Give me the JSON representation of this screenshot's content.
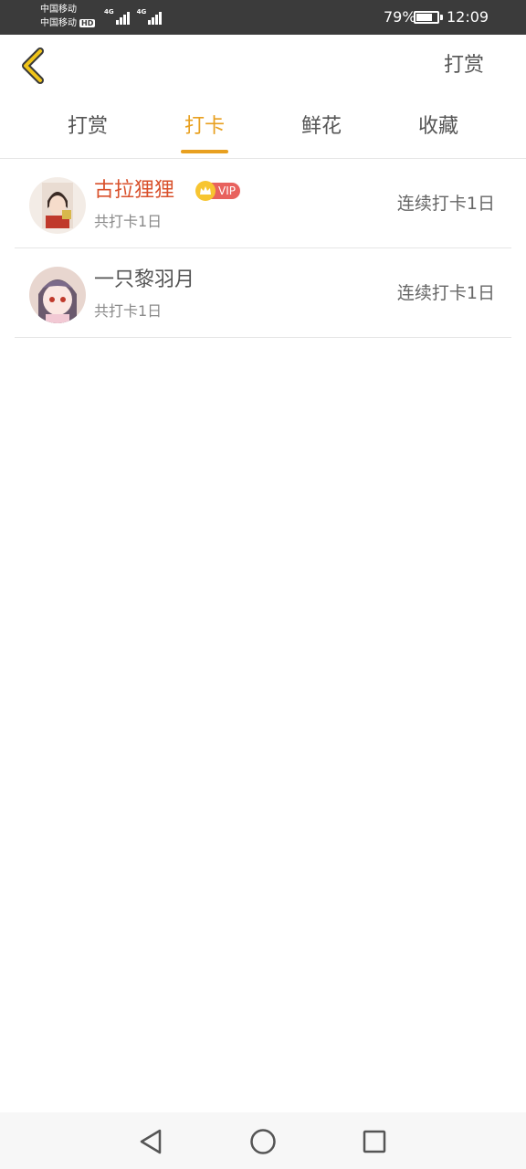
{
  "status_bar": {
    "carrier1": "中国移动",
    "carrier2": "中国移动",
    "hd": "HD",
    "network1": "4G",
    "network2": "4G",
    "battery_percent": "79%",
    "battery_level": 0.79,
    "time": "12:09"
  },
  "header": {
    "back_icon": "chevron-left-icon",
    "action_label": "打赏"
  },
  "tabs": [
    {
      "label": "打赏",
      "active": false
    },
    {
      "label": "打卡",
      "active": true
    },
    {
      "label": "鲜花",
      "active": false
    },
    {
      "label": "收藏",
      "active": false
    }
  ],
  "colors": {
    "accent": "#e8a020",
    "vip_name": "#d9512c",
    "vip_badge": "#e8625e",
    "vip_crown": "#f7c531"
  },
  "list": [
    {
      "name": "古拉狸狸",
      "vip": true,
      "vip_label": "VIP",
      "sub": "共打卡1日",
      "streak": "连续打卡1日"
    },
    {
      "name": "一只黎羽月",
      "vip": false,
      "sub": "共打卡1日",
      "streak": "连续打卡1日"
    }
  ],
  "nav_bar": {
    "back_icon": "triangle-back-icon",
    "home_icon": "circle-home-icon",
    "recents_icon": "square-recents-icon"
  }
}
